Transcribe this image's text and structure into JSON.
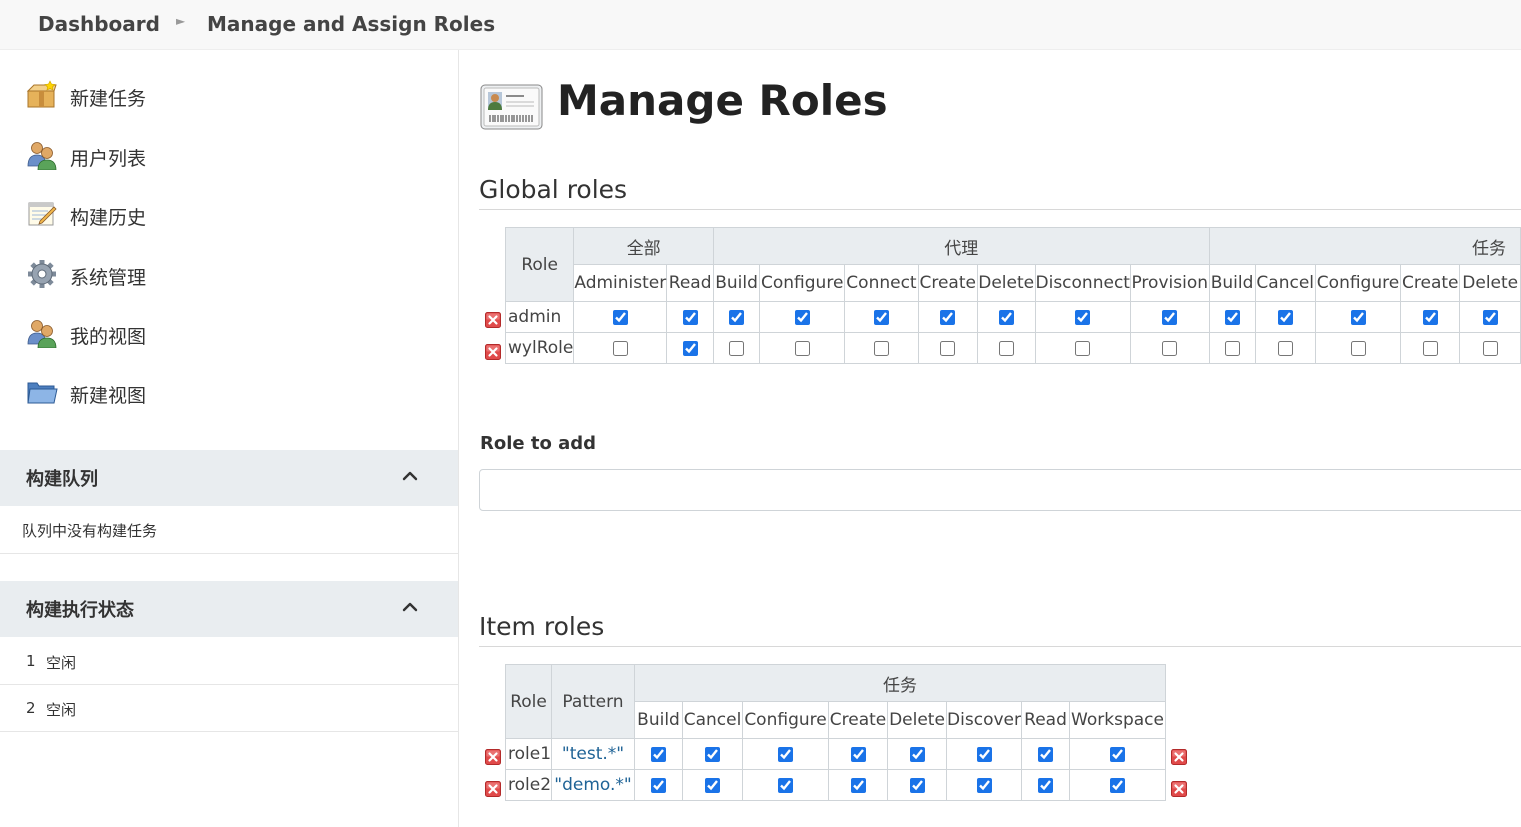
{
  "breadcrumb": {
    "home": "Dashboard",
    "current": "Manage and Assign Roles"
  },
  "sidebar": {
    "tasks": [
      {
        "label": "新建任务",
        "icon": "new-item-icon"
      },
      {
        "label": "用户列表",
        "icon": "users-icon"
      },
      {
        "label": "构建历史",
        "icon": "build-history-icon"
      },
      {
        "label": "系统管理",
        "icon": "gear-icon"
      },
      {
        "label": "我的视图",
        "icon": "users-icon"
      },
      {
        "label": "新建视图",
        "icon": "folder-icon"
      }
    ],
    "build_queue": {
      "title": "构建队列",
      "empty_text": "队列中没有构建任务"
    },
    "executor_status": {
      "title": "构建执行状态",
      "executors": [
        {
          "num": "1",
          "state": "空闲"
        },
        {
          "num": "2",
          "state": "空闲"
        }
      ]
    }
  },
  "page_title": "Manage Roles",
  "global_roles": {
    "title": "Global roles",
    "role_header": "Role",
    "groups": [
      {
        "name": "全部",
        "perms": [
          "Administer",
          "Read"
        ]
      },
      {
        "name": "代理",
        "perms": [
          "Build",
          "Configure",
          "Connect",
          "Create",
          "Delete",
          "Disconnect",
          "Provision"
        ]
      },
      {
        "name": "任务",
        "perms": [
          "Build",
          "Cancel",
          "Configure",
          "Create",
          "Delete"
        ]
      }
    ],
    "rows": [
      {
        "role": "admin",
        "checked": [
          true,
          true,
          true,
          true,
          true,
          true,
          true,
          true,
          true,
          true,
          true,
          true,
          true,
          true
        ]
      },
      {
        "role": "wylRole",
        "checked": [
          false,
          true,
          false,
          false,
          false,
          false,
          false,
          false,
          false,
          false,
          false,
          false,
          false,
          false
        ]
      }
    ]
  },
  "role_to_add": {
    "label": "Role to add",
    "value": "",
    "placeholder": ""
  },
  "item_roles": {
    "title": "Item roles",
    "role_header": "Role",
    "pattern_header": "Pattern",
    "group": "任务",
    "perms": [
      "Build",
      "Cancel",
      "Configure",
      "Create",
      "Delete",
      "Discover",
      "Read",
      "Workspace"
    ],
    "rows": [
      {
        "role": "role1",
        "pattern": "\"test.*\"",
        "checked": [
          true,
          true,
          true,
          true,
          true,
          true,
          true,
          true
        ]
      },
      {
        "role": "role2",
        "pattern": "\"demo.*\"",
        "checked": [
          true,
          true,
          true,
          true,
          true,
          true,
          true,
          true
        ]
      }
    ]
  }
}
